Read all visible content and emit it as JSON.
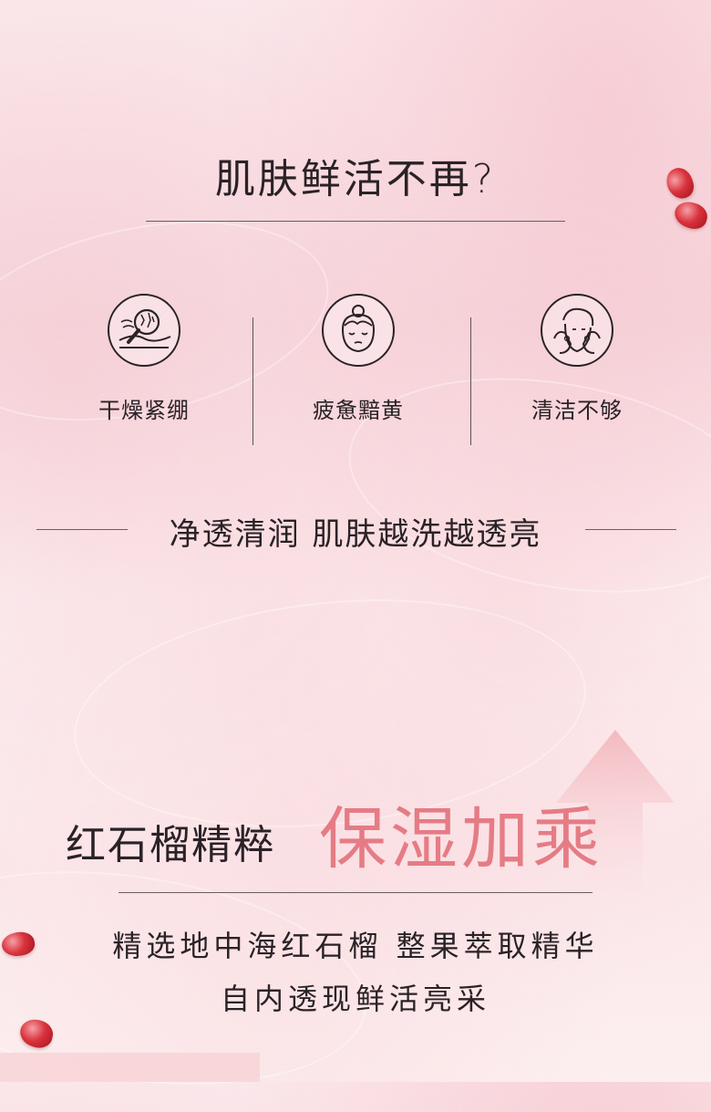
{
  "section_top": {
    "title": "肌肤鲜活不再?"
  },
  "features": [
    {
      "icon": "cracked-skin-magnifier-icon",
      "label": "干燥紧绷"
    },
    {
      "icon": "tired-face-icon",
      "label": "疲惫黯黄"
    },
    {
      "icon": "face-washing-icon",
      "label": "清洁不够"
    }
  ],
  "tagline": "净透清润 肌肤越洗越透亮",
  "headline": {
    "left": "红石榴精粹",
    "right": "保湿加乘"
  },
  "description": {
    "line1": "精选地中海红石榴 整果萃取精华",
    "line2": "自内透现鲜活亮采"
  },
  "colors": {
    "accent": "#e57c85",
    "text": "#2a2226",
    "seed": "#d9333d"
  }
}
